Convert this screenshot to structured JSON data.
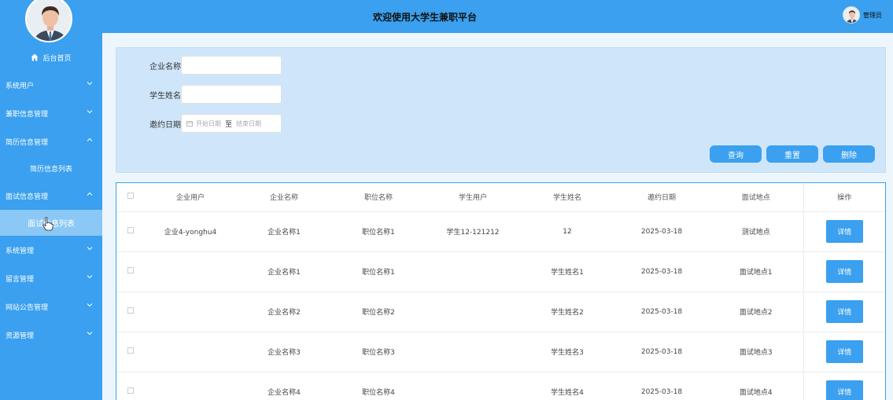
{
  "header": {
    "title": "欢迎使用大学生兼职平台",
    "user_name": "管理员"
  },
  "sidebar": {
    "home_label": "后台首页",
    "menus": [
      {
        "label": "系统用户",
        "expanded": false
      },
      {
        "label": "兼职信息管理",
        "expanded": false
      },
      {
        "label": "简历信息管理",
        "expanded": true,
        "children": [
          "简历信息列表"
        ]
      },
      {
        "label": "面试信息管理",
        "expanded": true,
        "children": [
          "面试信息列表"
        ]
      },
      {
        "label": "系统管理",
        "expanded": false
      },
      {
        "label": "留言管理",
        "expanded": false
      },
      {
        "label": "网站公告管理",
        "expanded": false
      },
      {
        "label": "资源管理",
        "expanded": false
      }
    ]
  },
  "search": {
    "company_label": "企业名称",
    "company_value": "",
    "student_label": "学生姓名",
    "student_value": "",
    "date_label": "邀约日期",
    "date_start_placeholder": "开始日期",
    "date_sep": "至",
    "date_end_placeholder": "结束日期",
    "query_btn": "查询",
    "reset_btn": "重置",
    "delete_btn": "删除"
  },
  "table": {
    "columns": [
      "企业用户",
      "企业名称",
      "职位名称",
      "学生用户",
      "学生姓名",
      "邀约日期",
      "面试地点",
      "操作"
    ],
    "rows": [
      [
        "企业4-yonghu4",
        "企业名称1",
        "职位名称1",
        "学生12-121212",
        "12",
        "2025-03-18",
        "测试地点"
      ],
      [
        "",
        "企业名称1",
        "职位名称1",
        "",
        "学生姓名1",
        "2025-03-18",
        "面试地点1"
      ],
      [
        "",
        "企业名称2",
        "职位名称2",
        "",
        "学生姓名2",
        "2025-03-18",
        "面试地点2"
      ],
      [
        "",
        "企业名称3",
        "职位名称3",
        "",
        "学生姓名3",
        "2025-03-18",
        "面试地点3"
      ],
      [
        "",
        "企业名称4",
        "职位名称4",
        "",
        "学生姓名4",
        "2025-03-18",
        "面试地点4"
      ]
    ],
    "detail_label": "详情"
  },
  "colors": {
    "primary": "#3aa0ef",
    "panel": "#cfe6fa",
    "active_sub": "#8bc8f5"
  }
}
